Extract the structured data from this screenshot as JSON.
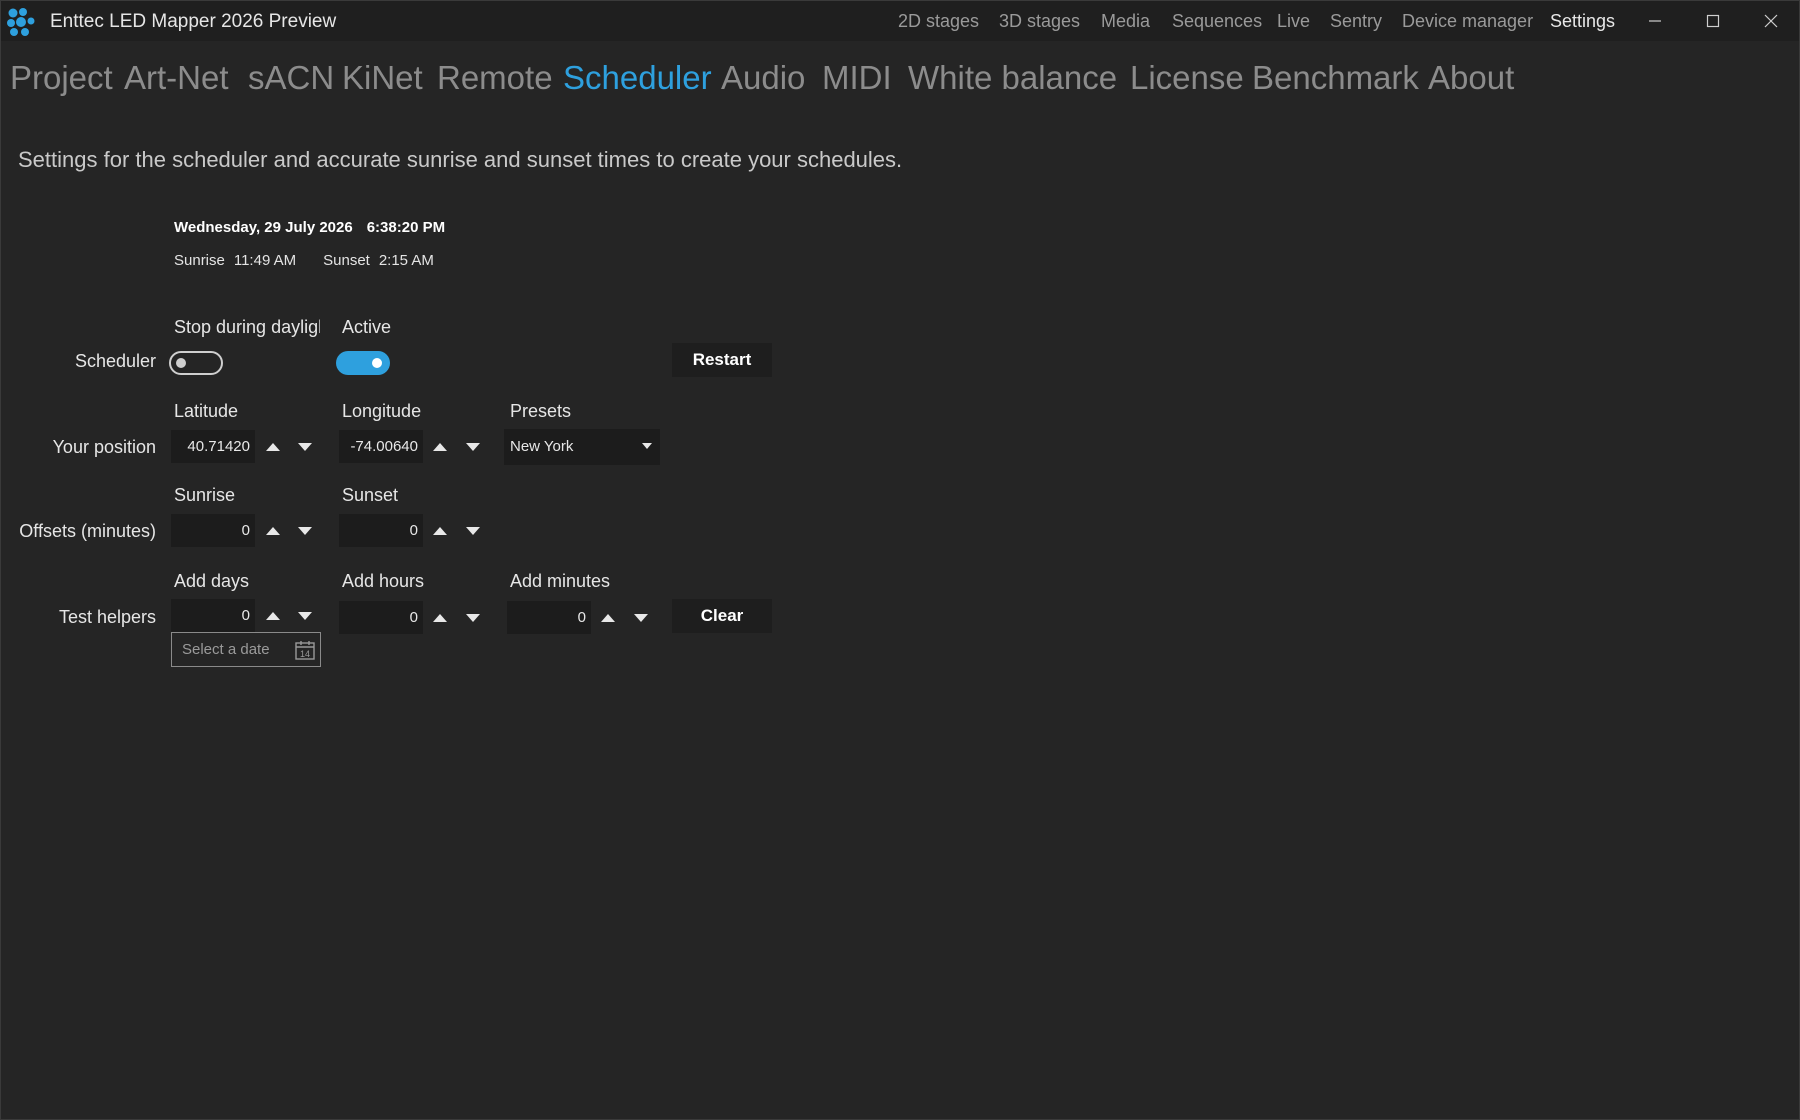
{
  "window": {
    "title": "Enttec LED Mapper 2026 Preview"
  },
  "top_nav": [
    {
      "label": "2D stages",
      "selected": false
    },
    {
      "label": "3D stages",
      "selected": false
    },
    {
      "label": "Media",
      "selected": false
    },
    {
      "label": "Sequences",
      "selected": false
    },
    {
      "label": "Live",
      "selected": false
    },
    {
      "label": "Sentry",
      "selected": false
    },
    {
      "label": "Device manager",
      "selected": false
    },
    {
      "label": "Settings",
      "selected": true
    }
  ],
  "settings_tabs": [
    {
      "label": "Project",
      "selected": false
    },
    {
      "label": "Art-Net",
      "selected": false
    },
    {
      "label": "sACN",
      "selected": false
    },
    {
      "label": "KiNet",
      "selected": false
    },
    {
      "label": "Remote",
      "selected": false
    },
    {
      "label": "Scheduler",
      "selected": true
    },
    {
      "label": "Audio",
      "selected": false
    },
    {
      "label": "MIDI",
      "selected": false
    },
    {
      "label": "White balance",
      "selected": false
    },
    {
      "label": "License",
      "selected": false
    },
    {
      "label": "Benchmark",
      "selected": false
    },
    {
      "label": "About",
      "selected": false
    }
  ],
  "scheduler": {
    "description": "Settings for the scheduler and accurate sunrise and sunset times to create your schedules.",
    "date": "Wednesday, 29 July 2026",
    "time": "6:38:20 PM",
    "sunrise_label": "Sunrise",
    "sunrise_time": "11:49 AM",
    "sunset_label": "Sunset",
    "sunset_time": "2:15 AM",
    "scheduler_row": {
      "row_label": "Scheduler",
      "stop_daylight_label": "Stop during daylight",
      "stop_daylight_on": false,
      "active_label": "Active",
      "active_on": true,
      "restart_label": "Restart"
    },
    "position_row": {
      "row_label": "Your position",
      "latitude_label": "Latitude",
      "latitude_value": "40.71420",
      "longitude_label": "Longitude",
      "longitude_value": "-74.00640",
      "presets_label": "Presets",
      "presets_value": "New York"
    },
    "offsets_row": {
      "row_label": "Offsets (minutes)",
      "sunrise_label": "Sunrise",
      "sunrise_value": "0",
      "sunset_label": "Sunset",
      "sunset_value": "0"
    },
    "test_row": {
      "row_label": "Test helpers",
      "add_days_label": "Add days",
      "add_days_value": "0",
      "add_hours_label": "Add hours",
      "add_hours_value": "0",
      "add_minutes_label": "Add minutes",
      "add_minutes_value": "0",
      "clear_label": "Clear",
      "date_placeholder": "Select a date"
    }
  },
  "colors": {
    "accent": "#2ea0de",
    "background": "#252525",
    "titlebar": "#1f1f1f",
    "input_bg": "#1c1c1c"
  }
}
